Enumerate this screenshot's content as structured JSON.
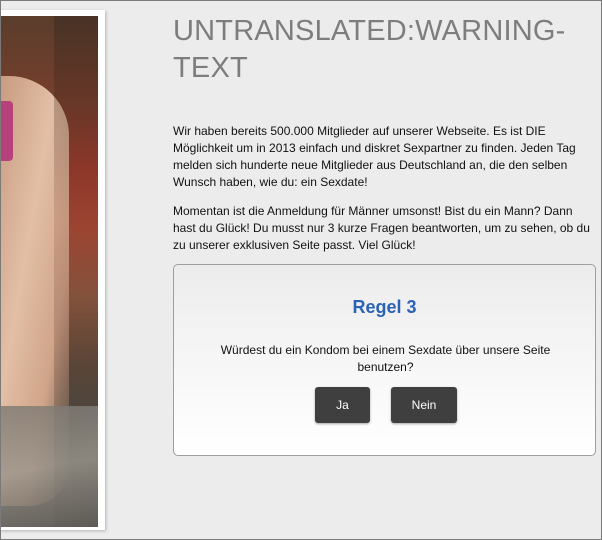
{
  "page": {
    "warning_title": "UNTRANSLATED:WARNING-TEXT",
    "intro_paragraph_1": "Wir haben bereits 500.000 Mitglieder auf unserer Webseite. Es ist DIE Möglichkeit um in 2013 einfach und diskret Sexpartner zu finden. Jeden Tag melden sich hunderte neue Mitglieder aus Deutschland an, die den selben Wunsch haben, wie du: ein Sexdate!",
    "intro_paragraph_2": "Momentan ist die Anmeldung für Männer umsonst! Bist du ein Mann? Dann hast du Glück! Du musst nur 3 kurze Fragen beantworten, um zu sehen, ob du zu unserer exklusiven Seite passt. Viel Glück!"
  },
  "question": {
    "title": "Regel 3",
    "text": "Würdest du ein Kondom bei einem Sexdate über unsere Seite benutzen?",
    "yes_label": "Ja",
    "no_label": "Nein"
  },
  "colors": {
    "accent_blue": "#2a63b5",
    "button_bg": "#3f3f3f",
    "title_gray": "#7d7d7d",
    "background": "#ececec"
  }
}
